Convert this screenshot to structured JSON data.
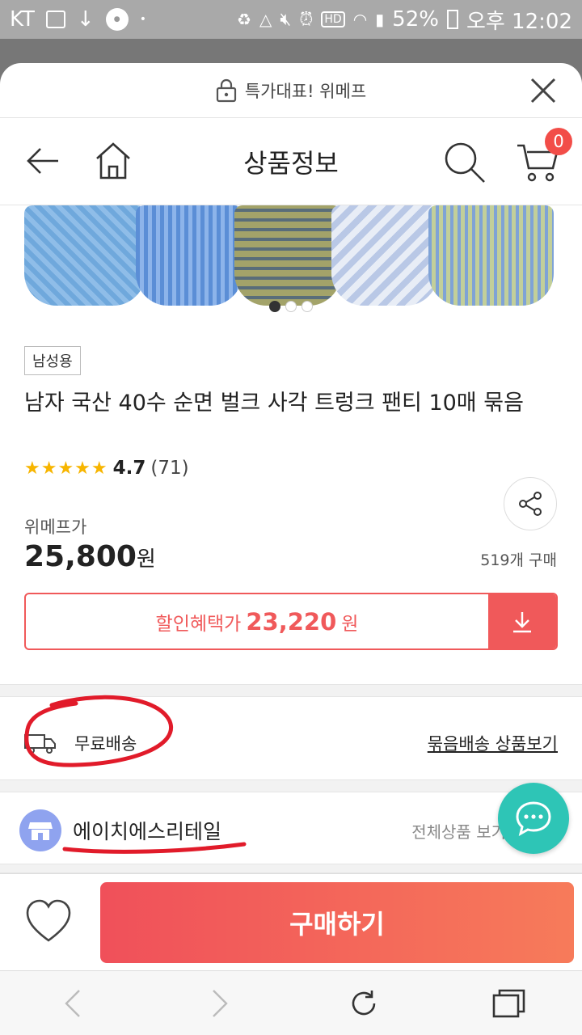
{
  "statusbar": {
    "carrier": "KT",
    "battery": "52%",
    "time": "오후 12:02",
    "hd": "HD"
  },
  "promo": {
    "text": "특가대표! 위메프"
  },
  "nav": {
    "title": "상품정보",
    "cart_count": "0"
  },
  "product": {
    "tag": "남성용",
    "title": "남자 국산 40수 순면 벌크 사각 트렁크 팬티 10매 묶음",
    "stars": "★★★★★",
    "rating": "4.7",
    "reviews": "(71)",
    "price_label": "위메프가",
    "price": "25,800",
    "price_unit": "원",
    "buys": "519개 구매"
  },
  "coupon": {
    "label": "할인혜택가",
    "price": "23,220",
    "unit": "원"
  },
  "shipping": {
    "label": "무료배송",
    "link": "묶음배송 상품보기"
  },
  "seller": {
    "name": "에이치에스리테일",
    "all_products": "전체상품 보기"
  },
  "actions": {
    "buy": "구매하기"
  },
  "colors": {
    "accent": "#f0595a",
    "chat": "#2ec5b6",
    "annotation": "#e11b2a"
  }
}
